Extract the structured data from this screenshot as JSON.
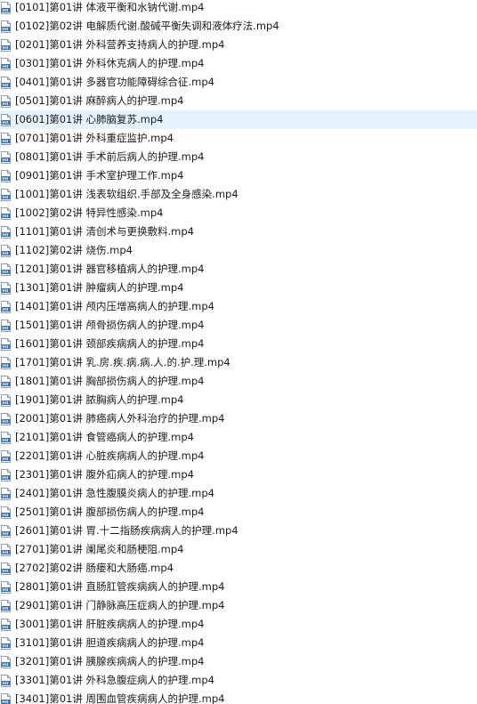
{
  "files": {
    "selected_index": 6,
    "icon": "video-file-icon",
    "colors": {
      "selected_background": "#e5f3ff",
      "text": "#1a1a1a",
      "icon_body": "#ffffff",
      "icon_border": "#8a9fb8",
      "icon_band": "#3c6fb5"
    },
    "items": [
      {
        "name": "[0101]第01讲 体液平衡和水钠代谢.mp4"
      },
      {
        "name": "[0102]第02讲 电解质代谢.酸碱平衡失调和液体疗法.mp4"
      },
      {
        "name": "[0201]第01讲 外科营养支持病人的护理.mp4"
      },
      {
        "name": "[0301]第01讲 外科休克病人的护理.mp4"
      },
      {
        "name": "[0401]第01讲 多器官功能障碍综合征.mp4"
      },
      {
        "name": "[0501]第01讲 麻醉病人的护理.mp4"
      },
      {
        "name": "[0601]第01讲 心肺脑复苏.mp4"
      },
      {
        "name": "[0701]第01讲 外科重症监护.mp4"
      },
      {
        "name": "[0801]第01讲 手术前后病人的护理.mp4"
      },
      {
        "name": "[0901]第01讲 手术室护理工作.mp4"
      },
      {
        "name": "[1001]第01讲 浅表软组织.手部及全身感染.mp4"
      },
      {
        "name": "[1002]第02讲 特异性感染.mp4"
      },
      {
        "name": "[1101]第01讲 清创术与更换敷料.mp4"
      },
      {
        "name": "[1102]第02讲 烧伤.mp4"
      },
      {
        "name": "[1201]第01讲 器官移植病人的护理.mp4"
      },
      {
        "name": "[1301]第01讲 肿瘤病人的护理.mp4"
      },
      {
        "name": "[1401]第01讲 颅内压增高病人的护理.mp4"
      },
      {
        "name": "[1501]第01讲 颅骨损伤病人的护理.mp4"
      },
      {
        "name": "[1601]第01讲 颈部疾病病人的护理.mp4"
      },
      {
        "name": "[1701]第01讲 乳.房.疾.病.病.人.的.护.理.mp4"
      },
      {
        "name": "[1801]第01讲 胸部损伤病人的护理.mp4"
      },
      {
        "name": "[1901]第01讲 脓胸病人的护理.mp4"
      },
      {
        "name": "[2001]第01讲 肺癌病人外科治疗的护理.mp4"
      },
      {
        "name": "[2101]第01讲 食管癌病人的护理.mp4"
      },
      {
        "name": "[2201]第01讲 心脏疾病病人的护理.mp4"
      },
      {
        "name": "[2301]第01讲 腹外疝病人的护理.mp4"
      },
      {
        "name": "[2401]第01讲 急性腹膜炎病人的护理.mp4"
      },
      {
        "name": "[2501]第01讲 腹部损伤病人的护理.mp4"
      },
      {
        "name": "[2601]第01讲 胃.十二指肠疾病病人的护理.mp4"
      },
      {
        "name": "[2701]第01讲 阑尾炎和肠梗阻.mp4"
      },
      {
        "name": "[2702]第02讲 肠瘘和大肠癌.mp4"
      },
      {
        "name": "[2801]第01讲 直肠肛管疾病病人的护理.mp4"
      },
      {
        "name": "[2901]第01讲 门静脉高压症病人的护理.mp4"
      },
      {
        "name": "[3001]第01讲 肝脏疾病病人的护理.mp4"
      },
      {
        "name": "[3101]第01讲 胆道疾病病人的护理.mp4"
      },
      {
        "name": "[3201]第01讲 胰腺疾病病人的护理.mp4"
      },
      {
        "name": "[3301]第01讲 外科急腹症病人的护理.mp4"
      },
      {
        "name": "[3401]第01讲 周围血管疾病病人的护理.mp4"
      }
    ]
  }
}
